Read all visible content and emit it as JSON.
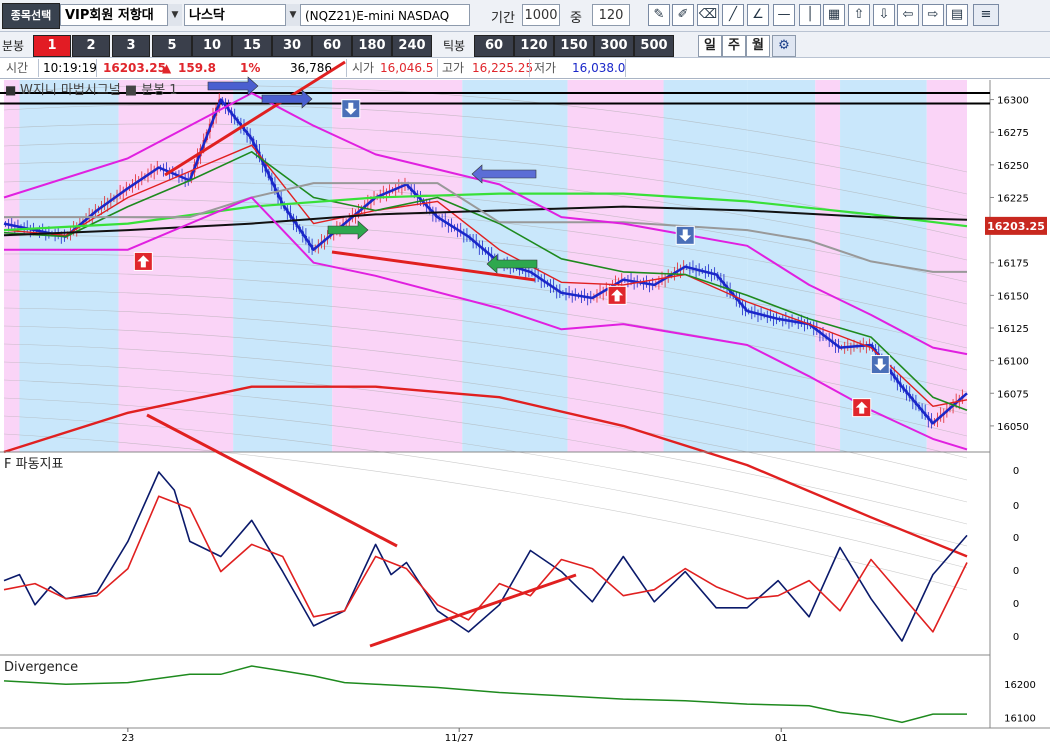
{
  "toolbar": {
    "stock_select": "종목선택",
    "group": "VIP회원 저항대",
    "market": "나스닥",
    "symbol": "(NQZ21)E-mini NASDAQ",
    "period_label": "기간",
    "period_value": "1000",
    "mid_label": "중",
    "mid_value": "120",
    "tools": [
      "pencil-icon",
      "note-icon",
      "eraser-icon",
      "line-icon",
      "angle-icon",
      "hline-icon",
      "vline-icon",
      "color-icon",
      "up-icon",
      "down-icon",
      "left-icon",
      "right-icon",
      "report-icon",
      "menu-icon"
    ],
    "tool_glyphs": [
      "✎",
      "✐",
      "⌫",
      "╱",
      "∠",
      "—",
      "│",
      "▦",
      "⇧",
      "⇩",
      "⇦",
      "⇨",
      "▤",
      "≡"
    ]
  },
  "periods": {
    "minute_label": "분봉",
    "minute_values": [
      "1",
      "2",
      "3",
      "5",
      "10",
      "15",
      "30",
      "60",
      "180",
      "240"
    ],
    "selected": "1",
    "tick_label": "틱봉",
    "tick_values": [
      "60",
      "120",
      "150",
      "300",
      "500"
    ],
    "day": "일",
    "week": "주",
    "month": "월",
    "settings": "⚙"
  },
  "quote": {
    "time_label": "시간",
    "time": "10:19:19",
    "price": "16203.25",
    "change_arrow": "▲",
    "change": "159.8",
    "change_pct": "1%",
    "volume": "36,786",
    "open_label": "시가",
    "open": "16,046.5",
    "high_label": "고가",
    "high": "16,225.25",
    "low_label": "저가",
    "low": "16,038.0"
  },
  "colors": {
    "pink_zone": "#fad4f7",
    "blue_zone": "#c9e7fb",
    "price_badge": "#c8281f",
    "up_red": "#e0262c",
    "down_blue": "#1a27c9",
    "oscillator_main": "#0b1a6b",
    "oscillator_signal": "#e02020",
    "divergence_line": "#1e8a1e"
  },
  "chart_data": [
    {
      "type": "line",
      "title": "W지니 마법시그널 ■ 분봉 1",
      "legend_marker": "■",
      "y_ticks": [
        16300,
        16275,
        16250,
        16225,
        16200,
        16175,
        16150,
        16125,
        16100,
        16075,
        16050
      ],
      "ylim": [
        16030,
        16315
      ],
      "current_price_label": "16203.25",
      "x_tick_labels": [
        "23",
        "11/27",
        "01"
      ],
      "series": [
        {
          "color": "#1a27c9",
          "x": [
            0,
            10,
            20,
            30,
            40,
            50,
            60,
            70,
            80,
            90,
            100,
            110,
            120,
            130,
            140,
            150,
            160,
            170,
            180,
            190,
            200,
            210,
            220,
            230,
            240,
            250,
            260,
            270,
            280,
            290,
            300,
            311
          ],
          "values": [
            16205,
            16200,
            16195,
            16215,
            16232,
            16248,
            16238,
            16300,
            16270,
            16220,
            16185,
            16205,
            16225,
            16235,
            16210,
            16195,
            16175,
            16168,
            16152,
            16148,
            16162,
            16158,
            16172,
            16166,
            16138,
            16132,
            16128,
            16110,
            16112,
            16080,
            16052,
            16075
          ]
        },
        {
          "color": "#e02020",
          "x": [
            0,
            20,
            40,
            60,
            80,
            100,
            120,
            140,
            160,
            180,
            200,
            220,
            240,
            260,
            280,
            300,
            311
          ],
          "values": [
            16200,
            16196,
            16225,
            16245,
            16265,
            16205,
            16215,
            16222,
            16185,
            16160,
            16158,
            16166,
            16145,
            16128,
            16110,
            16065,
            16070
          ]
        },
        {
          "color": "#1e8a1e",
          "x": [
            0,
            20,
            40,
            60,
            80,
            100,
            120,
            140,
            160,
            180,
            200,
            220,
            240,
            260,
            280,
            300,
            311
          ],
          "values": [
            16198,
            16195,
            16218,
            16238,
            16260,
            16225,
            16215,
            16225,
            16205,
            16178,
            16168,
            16166,
            16150,
            16132,
            16118,
            16072,
            16062
          ]
        },
        {
          "color": "#38e038",
          "x": [
            0,
            40,
            80,
            120,
            160,
            200,
            240,
            280,
            311
          ],
          "values": [
            16200,
            16205,
            16218,
            16225,
            16228,
            16228,
            16222,
            16212,
            16203
          ]
        },
        {
          "color": "#111111",
          "x": [
            0,
            40,
            80,
            120,
            160,
            200,
            240,
            280,
            311
          ],
          "values": [
            16196,
            16200,
            16205,
            16212,
            16215,
            16218,
            16215,
            16210,
            16208
          ]
        },
        {
          "color": "#999999",
          "x": [
            0,
            60,
            80,
            100,
            140,
            160,
            180,
            200,
            240,
            260,
            280,
            300,
            311
          ],
          "values": [
            16210,
            16210,
            16225,
            16236,
            16236,
            16206,
            16206,
            16206,
            16200,
            16192,
            16176,
            16168,
            16168
          ]
        },
        {
          "color": "#e020e0",
          "x": [
            0,
            40,
            80,
            100,
            120,
            160,
            180,
            200,
            240,
            260,
            280,
            300,
            311
          ],
          "values": [
            16225,
            16255,
            16305,
            16280,
            16258,
            16235,
            16210,
            16205,
            16188,
            16158,
            16135,
            16110,
            16105
          ]
        },
        {
          "color": "#e020e0",
          "x": [
            0,
            40,
            80,
            100,
            120,
            160,
            180,
            200,
            240,
            260,
            280,
            300,
            311
          ],
          "values": [
            16185,
            16185,
            16225,
            16175,
            16165,
            16140,
            16124,
            16128,
            16112,
            16088,
            16062,
            16040,
            16032
          ]
        },
        {
          "color": "#e02020",
          "x": [
            0,
            40,
            80,
            120,
            160,
            200,
            240,
            280,
            311
          ],
          "values": [
            16030,
            16060,
            16080,
            16080,
            16072,
            16050,
            16020,
            15980,
            15950
          ]
        }
      ],
      "markers": [
        {
          "type": "buy",
          "x": 45,
          "value": 16176
        },
        {
          "type": "sell",
          "x": 112,
          "value": 16293
        },
        {
          "type": "buy",
          "x": 198,
          "value": 16150
        },
        {
          "type": "sell",
          "x": 220,
          "value": 16196
        },
        {
          "type": "buy",
          "x": 277,
          "value": 16064
        },
        {
          "type": "sell",
          "x": 283,
          "value": 16097
        }
      ]
    },
    {
      "type": "line",
      "title": "F 파동지표",
      "y_ticks": [
        0,
        0,
        0,
        0,
        0,
        0
      ],
      "ylim": [
        0,
        6
      ],
      "series": [
        {
          "color": "#0b1a6b",
          "x": [
            0,
            5,
            10,
            15,
            20,
            30,
            40,
            50,
            55,
            60,
            70,
            80,
            90,
            100,
            110,
            120,
            125,
            130,
            140,
            150,
            160,
            170,
            180,
            185,
            190,
            200,
            210,
            220,
            230,
            240,
            250,
            260,
            270,
            280,
            290,
            300,
            311
          ],
          "values": [
            2.2,
            2.4,
            1.4,
            2.0,
            1.6,
            1.8,
            3.5,
            5.8,
            5.2,
            3.5,
            3.0,
            4.2,
            2.5,
            0.7,
            1.2,
            3.4,
            2.4,
            2.8,
            1.2,
            0.5,
            1.4,
            3.2,
            2.5,
            2.0,
            1.5,
            3.0,
            1.5,
            2.5,
            1.3,
            1.3,
            2.2,
            1.0,
            3.3,
            1.6,
            0.2,
            2.4,
            3.7
          ]
        },
        {
          "color": "#e02020",
          "x": [
            0,
            10,
            20,
            30,
            40,
            50,
            60,
            70,
            80,
            90,
            100,
            110,
            120,
            130,
            140,
            150,
            160,
            170,
            180,
            190,
            200,
            210,
            220,
            230,
            240,
            250,
            260,
            270,
            280,
            290,
            300,
            311
          ],
          "values": [
            1.9,
            2.1,
            1.6,
            1.7,
            2.6,
            5.0,
            4.6,
            2.5,
            3.4,
            3.0,
            1.0,
            1.2,
            3.0,
            2.6,
            1.4,
            0.9,
            2.1,
            1.7,
            2.9,
            2.6,
            1.7,
            1.9,
            2.6,
            2.0,
            1.6,
            1.7,
            2.2,
            1.2,
            2.9,
            1.7,
            0.5,
            2.8
          ]
        }
      ]
    },
    {
      "type": "line",
      "title": "Divergence",
      "y_ticks": [
        16200,
        16100
      ],
      "ylim": [
        16080,
        16270
      ],
      "series": [
        {
          "color": "#1e8a1e",
          "x": [
            0,
            20,
            40,
            60,
            70,
            80,
            90,
            100,
            110,
            120,
            140,
            160,
            180,
            200,
            220,
            240,
            260,
            270,
            280,
            290,
            300,
            311
          ],
          "values": [
            16210,
            16200,
            16205,
            16230,
            16230,
            16255,
            16240,
            16225,
            16205,
            16200,
            16190,
            16175,
            16165,
            16155,
            16150,
            16140,
            16135,
            16115,
            16105,
            16085,
            16110,
            16110
          ]
        }
      ]
    }
  ]
}
